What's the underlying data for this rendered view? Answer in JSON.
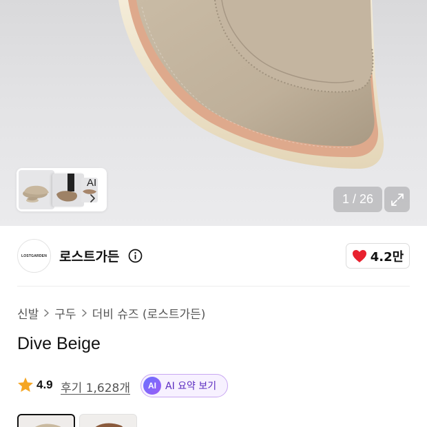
{
  "gallery": {
    "thumb_ai_label": "AI",
    "page_counter": "1 / 26"
  },
  "brand": {
    "logo_text": "LOSTGARDEN",
    "name": "로스트가든",
    "like_count": "4.2만"
  },
  "breadcrumb": {
    "items": [
      "신발",
      "구두",
      "더비 슈즈 (로스트가든)"
    ]
  },
  "product": {
    "title": "Dive Beige",
    "rating": "4.9",
    "reviews_label": "후기 1,628개",
    "ai_badge": "AI",
    "ai_summary_label": "AI 요약 보기"
  },
  "colors": {
    "heart": "#e8212e",
    "star": "#f5a623",
    "ai_accent": "#7c4dff"
  }
}
